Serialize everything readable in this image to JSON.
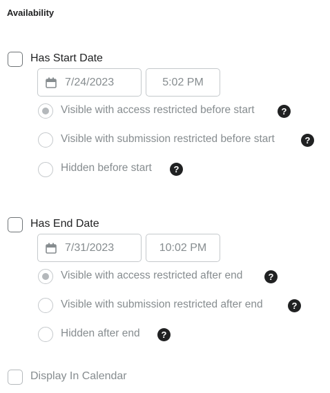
{
  "section": {
    "title": "Availability"
  },
  "start": {
    "checkbox_label": "Has Start Date",
    "date": "7/24/2023",
    "time": "5:02 PM",
    "options": [
      {
        "label": "Visible with access restricted before start",
        "selected": true
      },
      {
        "label": "Visible with submission restricted before start",
        "selected": false
      },
      {
        "label": "Hidden before start",
        "selected": false
      }
    ]
  },
  "end": {
    "checkbox_label": "Has End Date",
    "date": "7/31/2023",
    "time": "10:02 PM",
    "options": [
      {
        "label": "Visible with access restricted after end",
        "selected": true
      },
      {
        "label": "Visible with submission restricted after end",
        "selected": false
      },
      {
        "label": "Hidden after end",
        "selected": false
      }
    ]
  },
  "calendar": {
    "checkbox_label": "Display In Calendar"
  },
  "icons": {
    "calendar": "calendar-icon",
    "help": "help-icon",
    "help_glyph": "?"
  },
  "colors": {
    "text": "#202122",
    "muted": "#868c8f",
    "border": "#c4c8cb",
    "dot": "#b4b8bb"
  }
}
